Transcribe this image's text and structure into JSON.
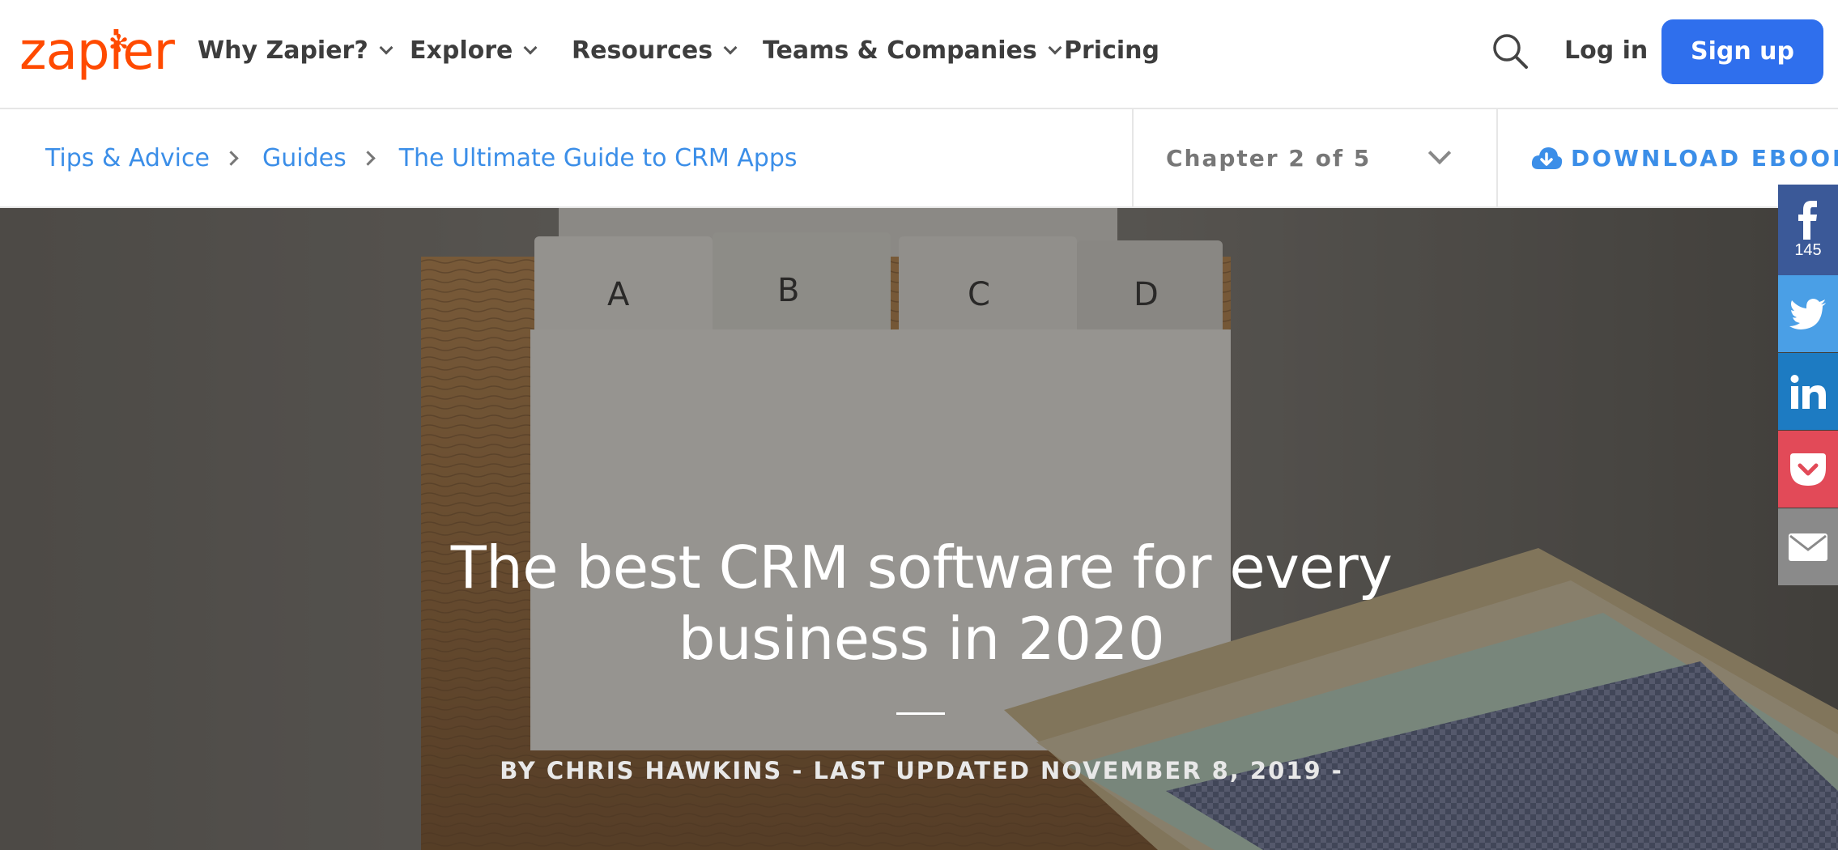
{
  "brand": {
    "name": "zapier",
    "color": "#ff4a00"
  },
  "nav": {
    "items": [
      {
        "label": "Why Zapier?",
        "has_dropdown": true
      },
      {
        "label": "Explore",
        "has_dropdown": true
      },
      {
        "label": "Resources",
        "has_dropdown": true
      },
      {
        "label": "Teams & Companies",
        "has_dropdown": true
      },
      {
        "label": "Pricing",
        "has_dropdown": false
      }
    ],
    "search_icon": "search-icon",
    "login_label": "Log in",
    "signup_label": "Sign up",
    "signup_color": "#2f6fed"
  },
  "breadcrumb": {
    "items": [
      "Tips & Advice",
      "Guides",
      "The Ultimate Guide to CRM Apps"
    ],
    "link_color": "#3b8ee8"
  },
  "chapter": {
    "label": "Chapter 2 of 5"
  },
  "download": {
    "label": "DOWNLOAD EBOOK",
    "icon": "cloud-download-icon"
  },
  "hero": {
    "title": "The best CRM software for every business in 2020",
    "byline": "BY CHRIS HAWKINS - LAST UPDATED NOVEMBER 8, 2019 -",
    "card_tabs": [
      "A",
      "B",
      "C",
      "D"
    ]
  },
  "share": {
    "facebook_count": "145",
    "items": [
      {
        "network": "facebook",
        "icon": "facebook-icon",
        "color": "#3b5998"
      },
      {
        "network": "twitter",
        "icon": "twitter-icon",
        "color": "#4a9fe6"
      },
      {
        "network": "linkedin",
        "icon": "linkedin-icon",
        "color": "#1d7bc2"
      },
      {
        "network": "pocket",
        "icon": "pocket-icon",
        "color": "#e24a58"
      },
      {
        "network": "email",
        "icon": "email-icon",
        "color": "#8a8a8a"
      }
    ]
  }
}
